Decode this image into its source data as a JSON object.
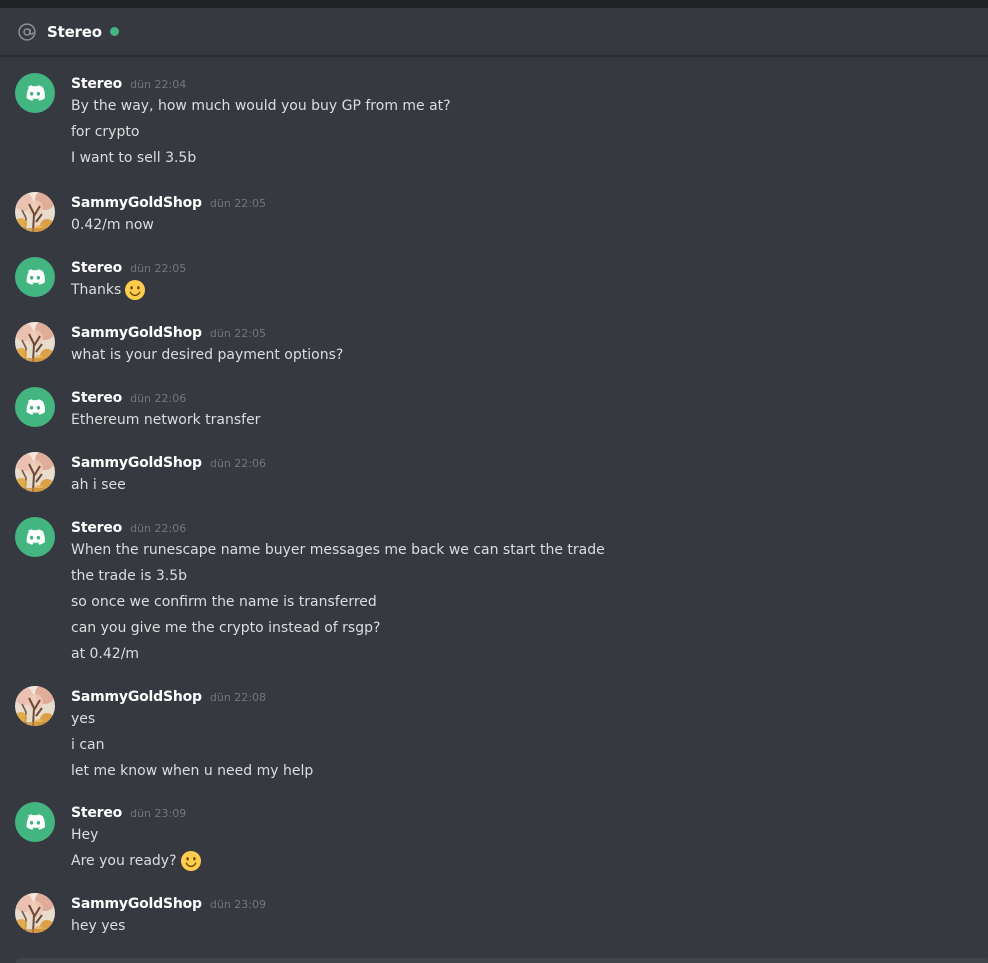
{
  "header": {
    "title": "Stereo",
    "status_color": "#43b581",
    "icon": "at-sign-icon"
  },
  "colors": {
    "background": "#36393f",
    "discord_green": "#43b581",
    "username": "#ffffff",
    "timestamp": "#72767d",
    "text": "#dcddde"
  },
  "messages": [
    {
      "author": "Stereo",
      "avatar": "discord-default-avatar",
      "time": "dün 22:04",
      "lines": [
        "By the way, how much would you buy GP from me at?",
        "for crypto",
        "I want to sell 3.5b"
      ]
    },
    {
      "author": "SammyGoldShop",
      "avatar": "autumn-tree-avatar",
      "time": "dün 22:05",
      "lines": [
        "0.42/m now"
      ]
    },
    {
      "author": "Stereo",
      "avatar": "discord-default-avatar",
      "time": "dün 22:05",
      "lines": [
        "Thanks"
      ],
      "emoji": "slightly-smiling-face"
    },
    {
      "author": "SammyGoldShop",
      "avatar": "autumn-tree-avatar",
      "time": "dün 22:05",
      "lines": [
        "what is your desired payment options?"
      ]
    },
    {
      "author": "Stereo",
      "avatar": "discord-default-avatar",
      "time": "dün 22:06",
      "lines": [
        "Ethereum network transfer"
      ]
    },
    {
      "author": "SammyGoldShop",
      "avatar": "autumn-tree-avatar",
      "time": "dün 22:06",
      "lines": [
        "ah i see"
      ]
    },
    {
      "author": "Stereo",
      "avatar": "discord-default-avatar",
      "time": "dün 22:06",
      "lines": [
        "When the runescape name buyer messages me back we can start the trade",
        "the trade is 3.5b",
        "so once we confirm the name is transferred",
        "can you give me the crypto instead of rsgp?",
        "at 0.42/m"
      ]
    },
    {
      "author": "SammyGoldShop",
      "avatar": "autumn-tree-avatar",
      "time": "dün 22:08",
      "lines": [
        "yes",
        "i can",
        "let me know when u need my help"
      ]
    },
    {
      "author": "Stereo",
      "avatar": "discord-default-avatar",
      "time": "dün 23:09",
      "lines": [
        "Hey",
        "Are you ready?"
      ],
      "emoji": "slightly-smiling-face"
    },
    {
      "author": "SammyGoldShop",
      "avatar": "autumn-tree-avatar",
      "time": "dün 23:09",
      "lines": [
        "hey yes"
      ]
    }
  ]
}
